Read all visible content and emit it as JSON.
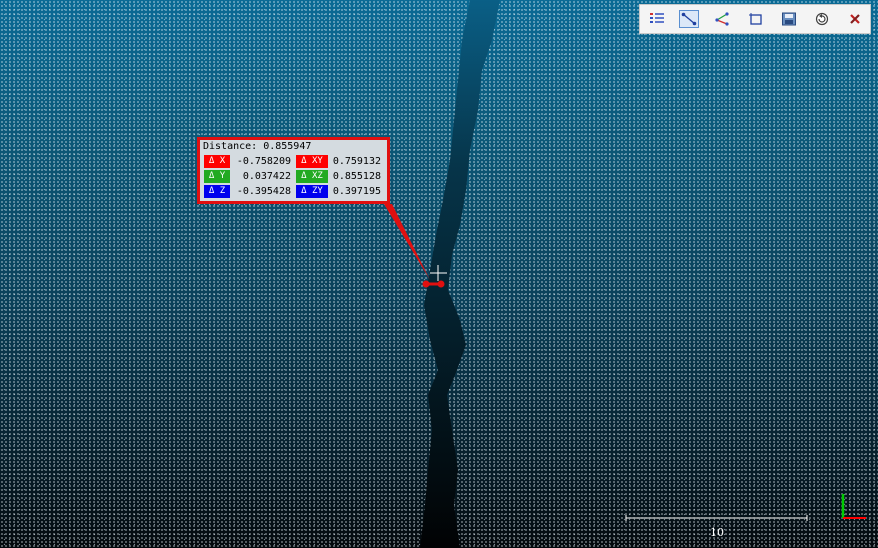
{
  "toolbar": {
    "buttons": [
      {
        "name": "label-list-button",
        "icon": "list-icon",
        "active": false
      },
      {
        "name": "point-distance-button",
        "icon": "distance-icon",
        "active": true
      },
      {
        "name": "angle-button",
        "icon": "angle-icon",
        "active": false
      },
      {
        "name": "area-button",
        "icon": "box-icon",
        "active": false
      },
      {
        "name": "save-button",
        "icon": "save-icon",
        "active": false
      },
      {
        "name": "reset-button",
        "icon": "reset-icon",
        "active": false
      },
      {
        "name": "close-button",
        "icon": "close-icon",
        "active": false
      }
    ]
  },
  "measurement": {
    "title": "Distance: 0.855947",
    "rows": [
      {
        "tag": "Δ X",
        "value": "-0.758209",
        "tag2": "Δ XY",
        "value2": "0.759132"
      },
      {
        "tag": "Δ Y",
        "value": "0.037422",
        "tag2": "Δ XZ",
        "value2": "0.855128"
      },
      {
        "tag": "Δ Z",
        "value": "-0.395428",
        "tag2": "Δ ZY",
        "value2": "0.397195"
      }
    ],
    "colors": {
      "x": "#ff0000",
      "y": "#22aa22",
      "z": "#0000ee",
      "border": "#e01010"
    }
  },
  "scale_bar": {
    "label": "10"
  },
  "axes": {
    "x_color": "#ff0000",
    "y_color": "#00cc00"
  }
}
